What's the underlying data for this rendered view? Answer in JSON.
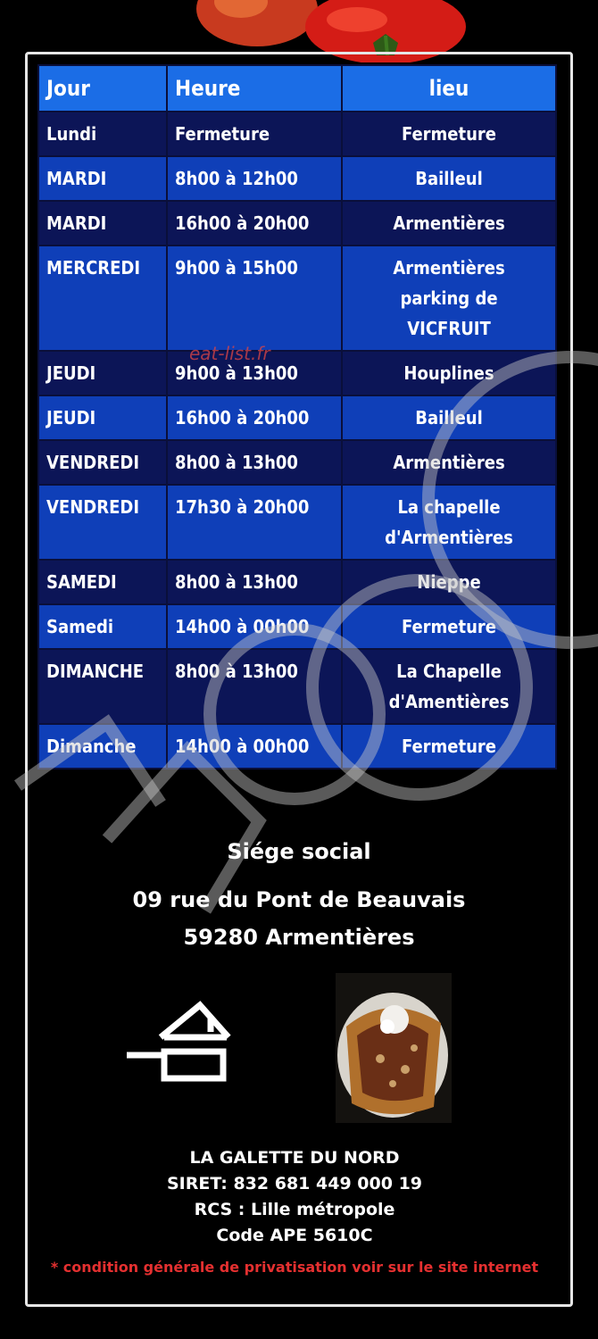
{
  "table": {
    "headers": {
      "jour": "Jour",
      "heure": "Heure",
      "lieu": "lieu"
    },
    "rows": [
      {
        "jour": "Lundi",
        "heure": "Fermeture",
        "lieu_lines": [
          "Fermeture"
        ]
      },
      {
        "jour": "MARDI",
        "heure": "8h00 à 12h00",
        "lieu_lines": [
          "Bailleul"
        ]
      },
      {
        "jour": "MARDI",
        "heure": "16h00 à 20h00",
        "lieu_lines": [
          "Armentières"
        ]
      },
      {
        "jour": "MERCREDI",
        "heure": "9h00 à 15h00",
        "lieu_lines": [
          "Armentières",
          "parking de",
          "VICFRUIT"
        ]
      },
      {
        "jour": "JEUDI",
        "heure": "9h00 à 13h00",
        "lieu_lines": [
          "Houplines"
        ]
      },
      {
        "jour": "JEUDI",
        "heure": "16h00 à 20h00",
        "lieu_lines": [
          "Bailleul"
        ]
      },
      {
        "jour": "VENDREDI",
        "heure": "8h00 à 13h00",
        "lieu_lines": [
          "Armentières"
        ]
      },
      {
        "jour": "VENDREDI",
        "heure": "17h30 à 20h00",
        "lieu_lines": [
          "La chapelle",
          "d'Armentières"
        ]
      },
      {
        "jour": "SAMEDI",
        "heure": "8h00 à 13h00",
        "lieu_lines": [
          "Nieppe"
        ]
      },
      {
        "jour": "Samedi",
        "heure": "14h00 à 00h00",
        "lieu_lines": [
          "Fermeture"
        ]
      },
      {
        "jour": "DIMANCHE",
        "heure": "8h00 à 13h00",
        "lieu_lines": [
          "La Chapelle",
          "d'Amentières"
        ]
      },
      {
        "jour": "Dimanche",
        "heure": "14h00 à 00h00",
        "lieu_lines": [
          "Fermeture"
        ]
      }
    ]
  },
  "watermark_text": "eat-list.fr",
  "siege": {
    "title": "Siége social",
    "address_line1": "09 rue du Pont de Beauvais",
    "address_line2": "59280 Armentières"
  },
  "footer": {
    "company": "LA GALETTE DU NORD",
    "siret": "SIRET: 832 681 449 000 19",
    "rcs": "RCS : Lille métropole",
    "ape": "Code APE 5610C",
    "condition": "* condition générale de privatisation voir sur le site internet"
  },
  "icons": {
    "logo": "house-logo-icon",
    "photo": "galette-photo",
    "decor": "tomatoes"
  },
  "colors": {
    "header_blue": "#1b6de6",
    "row_dark": "#0c1557",
    "row_blue": "#0f3fb8",
    "condition_red": "#e53030"
  }
}
